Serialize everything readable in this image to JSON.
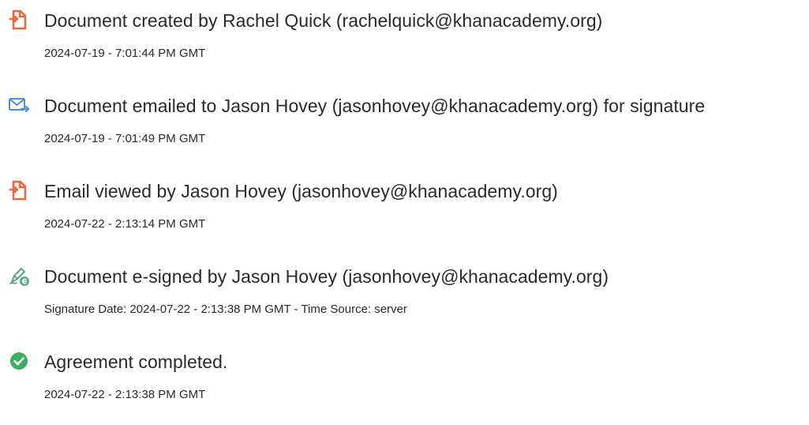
{
  "events": [
    {
      "icon": "document-created-icon",
      "icon_color": "#E8693F",
      "title": "Document created by Rachel Quick (rachelquick@khanacademy.org)",
      "timestamp": "2024-07-19 - 7:01:44 PM GMT"
    },
    {
      "icon": "email-sent-icon",
      "icon_color": "#4A90D9",
      "title": "Document emailed to Jason Hovey (jasonhovey@khanacademy.org) for signature",
      "timestamp": "2024-07-19 - 7:01:49 PM GMT"
    },
    {
      "icon": "email-viewed-icon",
      "icon_color": "#E8693F",
      "title": "Email viewed by Jason Hovey (jasonhovey@khanacademy.org)",
      "timestamp": "2024-07-22 - 2:13:14 PM GMT"
    },
    {
      "icon": "e-signed-pen-icon",
      "icon_color": "#5BA58C",
      "title": "Document e-signed by Jason Hovey (jasonhovey@khanacademy.org)",
      "timestamp": "Signature Date: 2024-07-22 - 2:13:38 PM GMT - Time Source: server"
    },
    {
      "icon": "agreement-completed-check-icon",
      "icon_color": "#3DAE5E",
      "title": "Agreement completed.",
      "timestamp": "2024-07-22 - 2:13:38 PM GMT"
    }
  ]
}
